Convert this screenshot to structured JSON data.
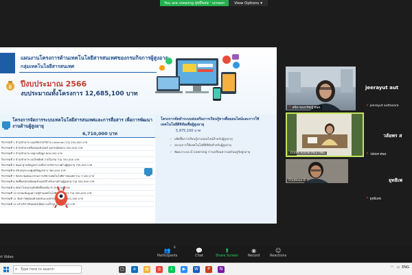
{
  "share_banner": {
    "status": "You are viewing ยุทธิพงษ ' screen",
    "options_label": "View Options",
    "options_chevron": "chevron-down-icon"
  },
  "slide": {
    "title_line1": "แผนงานโครงการด้านเทคโนโลยีสารสนเทศของกรมกิจการผู้สูงอายุ",
    "title_line2": "กลุ่มเทคโนโลยีสารสนเทศ",
    "budget_year": "ปีงบประมาณ 2566",
    "budget_total": "งบประมาณทั้งโครงการ 12,685,100  บาท",
    "left": {
      "title": "โครงการจัดการระบบเทคโนโลยีสารสนเทศและการสื่อสาร เพื่อการพัฒนางานด้านผู้สูงอายุ",
      "budget": "6,710,000 บาท",
      "items": [
        "กิจกรรมที่ 1 บำรุงรักษาระบบเครือข่ายไร้สาย (Internet) รวม 250,000 บาท",
        "กิจกรรมที่ 2 บำรุงรักษาเครื่องคอมพิวเตอร์ อุปกรณ์ต่อพ่วง 500,000 บาท",
        "กิจกรรมที่ 3 บำรุงรักษาระบบฐานข้อมูล 800,000 บาท",
        "กิจกรรมที่ 4 บำรุงรักษาระบบโทรศัพท์ ภายในกรม รวม 350,000 บาท",
        "กิจกรรมที่ 5 พัฒนาฐานข้อมูลกลางเพื่อการบริหารงานด้านผู้สูงอายุ 750,000 บาท",
        "กิจกรรมที่ 6 ปรับปรุงระบบศูนย์ข้อมูลกลาง 380,000 บาท",
        "กิจกรรมที่ 7 จัดประชุมคณะกรรมการบริหารเทคโนโลยีสารสนเทศ รวม 7,000 บาท",
        "กิจกรรมที่ 8 จัดซื้อครุภัณฑ์คอมพิวเตอร์สำหรับงานด้านผู้สูงอายุ รวม 305,500 บาท",
        "กิจกรรมที่ 9 จัดหาโปรแกรมลิขสิทธิ์ซอฟต์แวร์ 250,000 บาท",
        "กิจกรรมที่ 10 อบรมเพิ่มพูนความรู้ด้านเทคโนโลยีแก่บุคลากร รวม 300,000 บาท",
        "กิจกรรมที่ 11 จัดหาวัสดุคอมพิวเตอร์และอุปกรณ์ต่อพ่วง 1,801,500 บาท",
        "กิจกรรมที่ 12 เช่าบริการอินเทอร์เน็ตความเร็วสูง 1,000,000 บาท"
      ]
    },
    "right": {
      "title": "โครงการจัดทำระบบส่งเสริมการเรียนรู้ทางสื่อออนไลน์และการใช้เทคโนโลยีดิจิทัลเพื่อผู้สูงอายุ",
      "budget": "5,975,100 บาท",
      "bullets": [
        "ผลิตสื่อการเรียนรู้ทางออนไลน์สำหรับผู้สูงอายุ",
        "อบรมการใช้เทคโนโลยีดิจิทัลสำหรับผู้สูงอายุ",
        "พัฒนาระบบ E-Learning การเตรียมความพร้อมสู่วัยสูงอายุ"
      ]
    }
  },
  "participants": [
    {
      "side_label": "jeerayut aut",
      "tile_label": "สนิท ทองปรัชญ์ ศพส.",
      "name": "jeerayut auttasara"
    },
    {
      "side_label": "วลัยพร ส",
      "tile_label": "ZOOM ROOM MEETING",
      "name": "วลัยพร ศพส."
    },
    {
      "side_label": "ยุทธิเพ",
      "tile_label": "Chutinun P.",
      "name": "ยุทธิเพช"
    }
  ],
  "toolbar": {
    "video_label": "rt Video",
    "participants_label": "Participants",
    "participants_count": "6",
    "chat_label": "Chat",
    "share_label": "Share Screen",
    "record_label": "Record",
    "reactions_label": "Reactions"
  },
  "taskbar": {
    "search_placeholder": "Type here to search",
    "tray_lang": "ENG"
  },
  "colors": {
    "share_green": "#23b14d",
    "active_speaker": "#c4e55d",
    "slide_blue": "#1d5da8"
  }
}
